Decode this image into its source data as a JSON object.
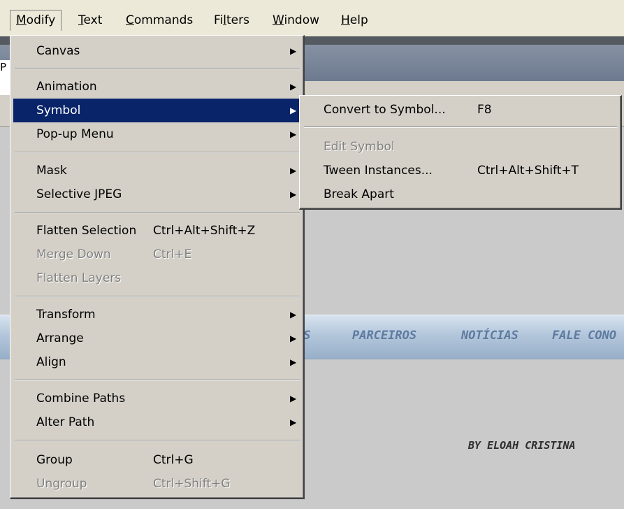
{
  "menubar": {
    "items": [
      {
        "label": "Modify",
        "mnemonic": "M",
        "rest": "odify"
      },
      {
        "label": "Text",
        "mnemonic": "T",
        "rest": "ext"
      },
      {
        "label": "Commands",
        "mnemonic": "C",
        "rest": "ommands"
      },
      {
        "label": "Filters",
        "pre": "Fi",
        "mnemonic": "l",
        "rest": "ters"
      },
      {
        "label": "Window",
        "mnemonic": "W",
        "rest": "indow"
      },
      {
        "label": "Help",
        "mnemonic": "H",
        "rest": "elp"
      }
    ]
  },
  "left_edge_text": "P",
  "modify_menu": {
    "items": [
      {
        "label": "Canvas",
        "submenu": true
      },
      {
        "label": "Animation",
        "submenu": true
      },
      {
        "label": "Symbol",
        "submenu": true,
        "highlighted": true
      },
      {
        "label": "Pop-up Menu",
        "submenu": true
      },
      {
        "label": "Mask",
        "submenu": true
      },
      {
        "label": "Selective JPEG",
        "submenu": true
      },
      {
        "label": "Flatten Selection",
        "shortcut": "Ctrl+Alt+Shift+Z"
      },
      {
        "label": "Merge Down",
        "shortcut": "Ctrl+E",
        "disabled": true
      },
      {
        "label": "Flatten Layers",
        "disabled": true
      },
      {
        "label": "Transform",
        "submenu": true
      },
      {
        "label": "Arrange",
        "submenu": true
      },
      {
        "label": "Align",
        "submenu": true
      },
      {
        "label": "Combine Paths",
        "submenu": true
      },
      {
        "label": "Alter Path",
        "submenu": true
      },
      {
        "label": "Group",
        "shortcut": "Ctrl+G"
      },
      {
        "label": "Ungroup",
        "shortcut": "Ctrl+Shift+G",
        "disabled": true
      }
    ]
  },
  "symbol_submenu": {
    "items": [
      {
        "label": "Convert to Symbol...",
        "shortcut": "F8"
      },
      {
        "label": "Edit Symbol",
        "disabled": true
      },
      {
        "label": "Tween Instances...",
        "shortcut": "Ctrl+Alt+Shift+T"
      },
      {
        "label": "Break Apart"
      }
    ]
  },
  "site_nav": {
    "items": [
      "OS",
      "PARCEIROS",
      "NOTÍCIAS",
      "FALE CONO"
    ]
  },
  "credit": "BY ELOAH CRISTINA",
  "colors": {
    "menu_bg": "#d4d0c8",
    "highlight_bg": "#0a246a",
    "disabled_text": "#808080",
    "nav_text": "#5d7b9f"
  },
  "icons": {
    "submenu_arrow": "▶"
  }
}
